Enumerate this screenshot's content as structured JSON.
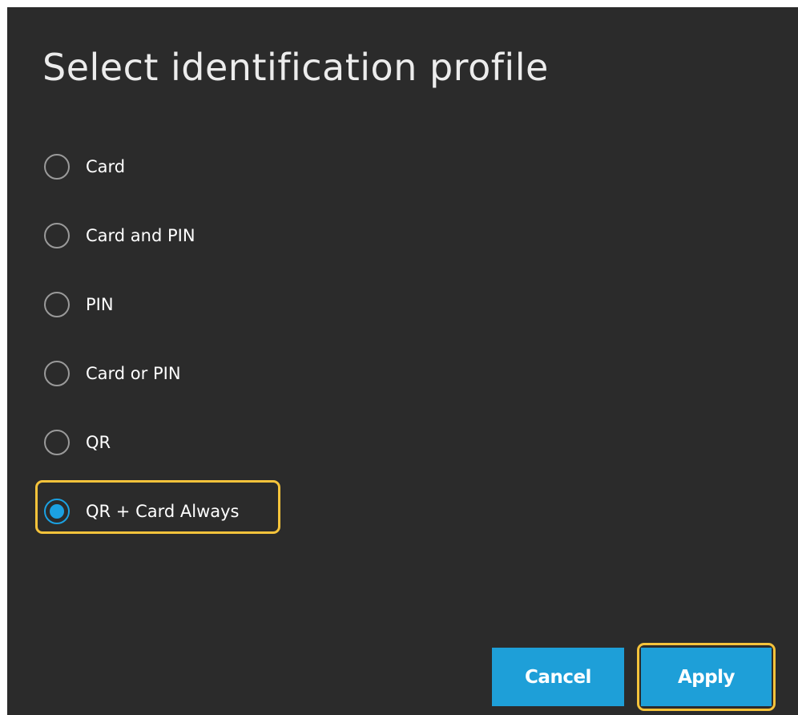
{
  "dialog": {
    "title": "Select identification profile"
  },
  "options": [
    {
      "label": "Card",
      "selected": false
    },
    {
      "label": "Card and PIN",
      "selected": false
    },
    {
      "label": "PIN",
      "selected": false
    },
    {
      "label": "Card or PIN",
      "selected": false
    },
    {
      "label": "QR",
      "selected": false
    },
    {
      "label": "QR + Card Always",
      "selected": true
    }
  ],
  "buttons": {
    "cancel_label": "Cancel",
    "apply_label": "Apply"
  },
  "colors": {
    "background": "#2b2b2b",
    "accent": "#1ba1e2",
    "button": "#1e9fd8",
    "highlight": "#f5c33b"
  }
}
